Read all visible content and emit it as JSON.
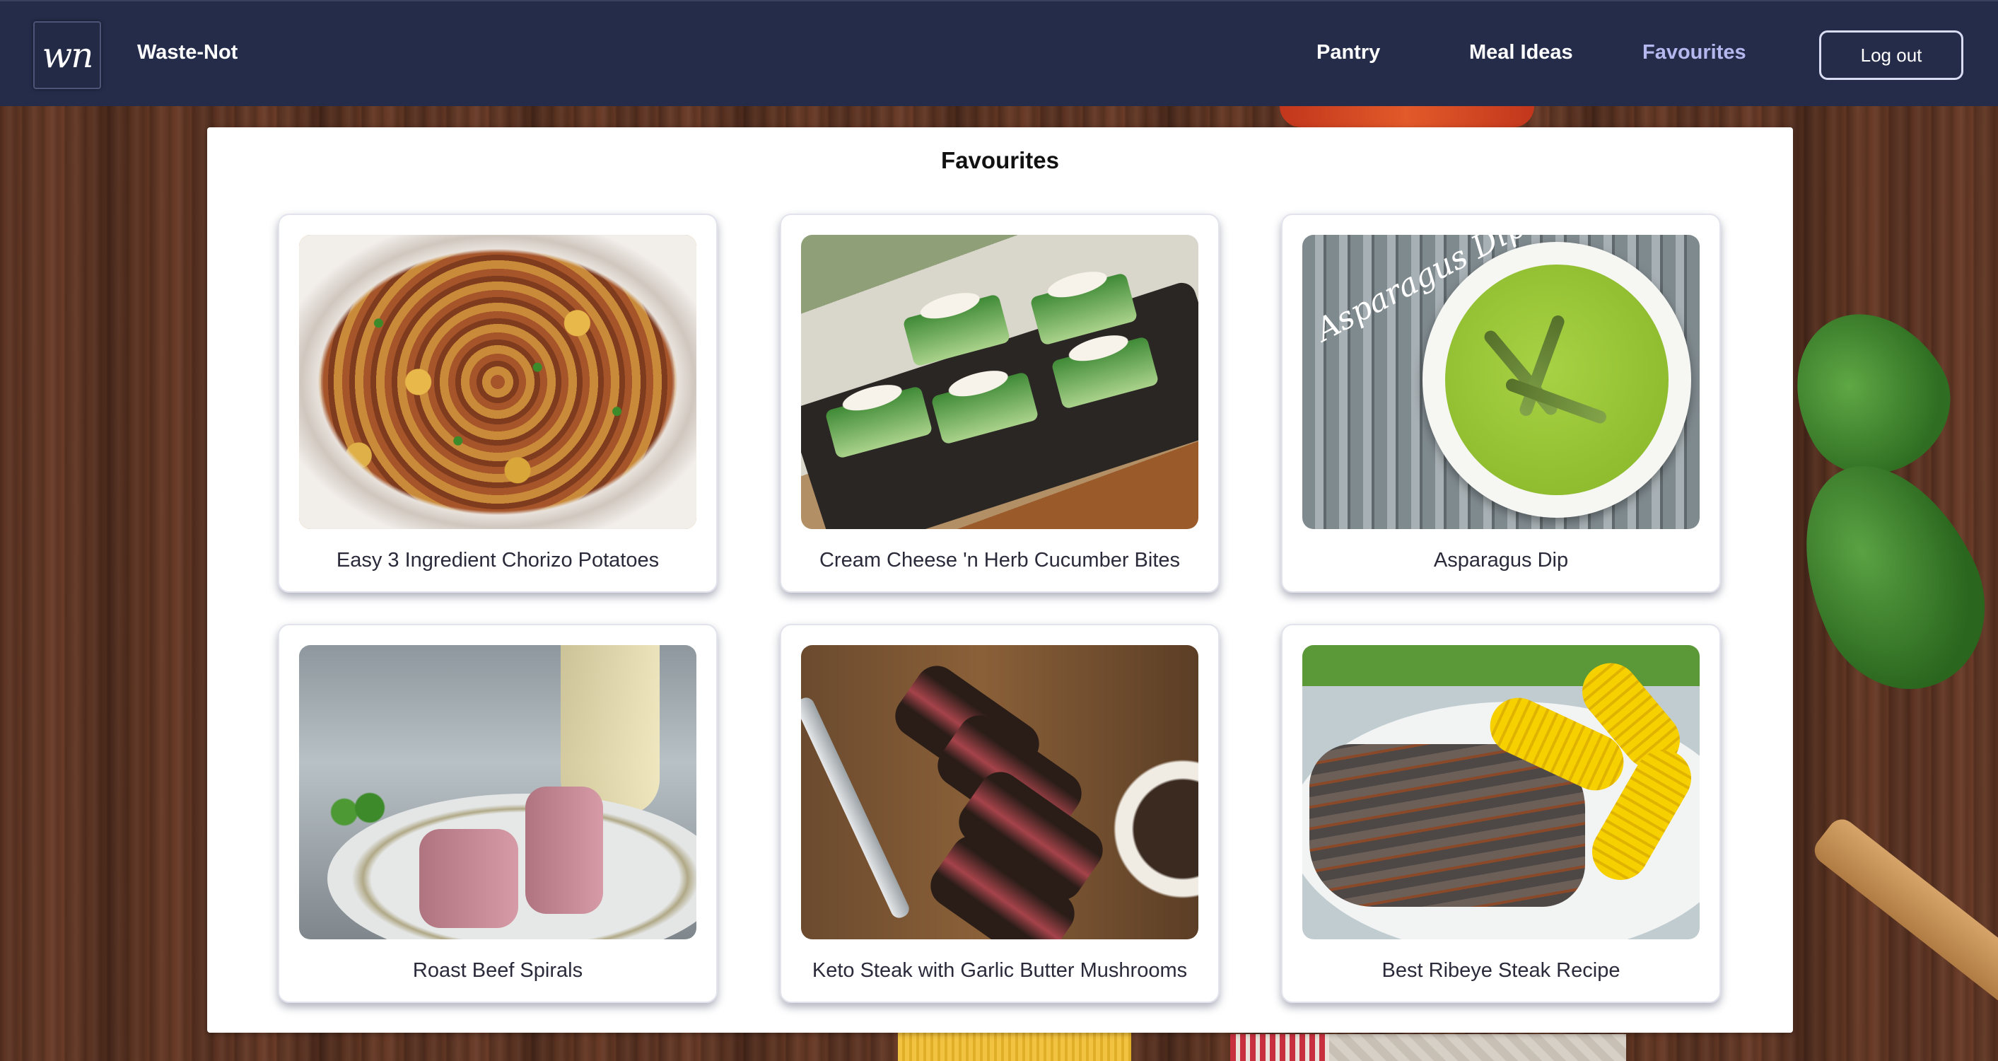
{
  "app": {
    "logo_text": "wn",
    "brand": "Waste-Not"
  },
  "nav": {
    "items": [
      {
        "label": "Pantry",
        "active": false
      },
      {
        "label": "Meal Ideas",
        "active": false
      },
      {
        "label": "Favourites",
        "active": true
      }
    ],
    "logout_label": "Log out"
  },
  "page": {
    "title": "Favourites"
  },
  "recipes": [
    {
      "title": "Easy 3 Ingredient Chorizo Potatoes",
      "image": "chorizo-potatoes-photo"
    },
    {
      "title": "Cream Cheese 'n Herb Cucumber Bites",
      "image": "cucumber-bites-photo"
    },
    {
      "title": "Asparagus Dip",
      "image": "asparagus-dip-photo",
      "image_text": "Asparagus Dip"
    },
    {
      "title": "Roast Beef Spirals",
      "image": "roast-beef-spirals-photo"
    },
    {
      "title": "Keto Steak with Garlic Butter Mushrooms",
      "image": "keto-steak-photo"
    },
    {
      "title": "Best Ribeye Steak Recipe",
      "image": "ribeye-steak-photo"
    }
  ],
  "colors": {
    "navbar_bg": "#252c4a",
    "nav_active": "#b4b8ee",
    "nav_text": "#ffffff",
    "panel_bg": "#ffffff"
  }
}
